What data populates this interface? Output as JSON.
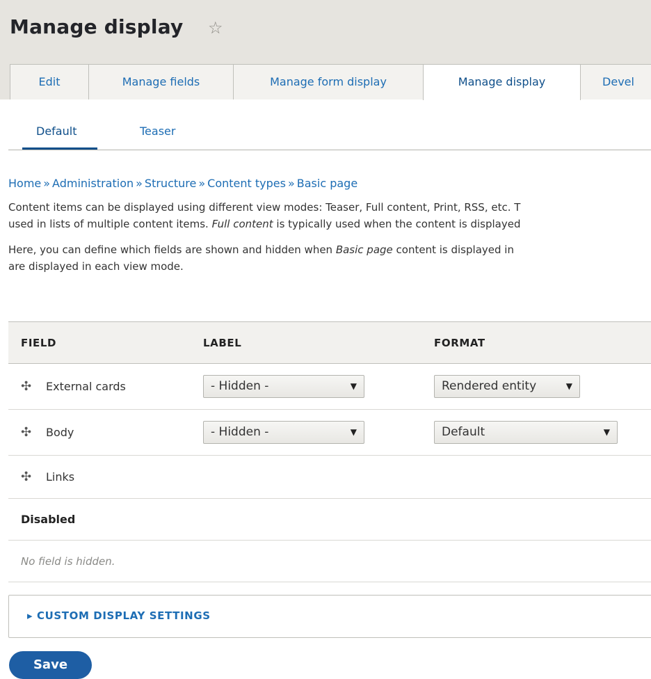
{
  "header": {
    "title": "Manage display",
    "star_icon": "☆"
  },
  "tabs": [
    {
      "label": "Edit",
      "active": false
    },
    {
      "label": "Manage fields",
      "active": false
    },
    {
      "label": "Manage form display",
      "active": false
    },
    {
      "label": "Manage display",
      "active": true
    },
    {
      "label": "Devel",
      "active": false
    }
  ],
  "secondary_tabs": [
    {
      "label": "Default",
      "active": true
    },
    {
      "label": "Teaser",
      "active": false
    }
  ],
  "breadcrumb": {
    "items": [
      "Home",
      "Administration",
      "Structure",
      "Content types",
      "Basic page"
    ],
    "separator": "»"
  },
  "description": {
    "p1_line1": "Content items can be displayed using different view modes: Teaser, Full content, Print, RSS, etc. T",
    "p1_line2_a": "used in lists of multiple content items. ",
    "p1_line2_em": "Full content",
    "p1_line2_b": " is typically used when the content is displayed",
    "p2_line1_a": "Here, you can define which fields are shown and hidden when ",
    "p2_line1_em": "Basic page",
    "p2_line1_b": " content is displayed in",
    "p2_line2": "are displayed in each view mode."
  },
  "table": {
    "headers": {
      "field": "FIELD",
      "label": "LABEL",
      "format": "FORMAT"
    },
    "rows": [
      {
        "name": "External cards",
        "label_value": "- Hidden -",
        "format_value": "Rendered entity"
      },
      {
        "name": "Body",
        "label_value": "- Hidden -",
        "format_value": "Default"
      },
      {
        "name": "Links"
      }
    ],
    "disabled_label": "Disabled",
    "empty_message": "No field is hidden."
  },
  "custom_display_settings": {
    "label": "CUSTOM DISPLAY SETTINGS",
    "icon": "▸"
  },
  "save_label": "Save",
  "icons": {
    "drag": "✣",
    "select_arrow": "▼"
  },
  "colors": {
    "link": "#1d6db4",
    "header_bg": "#e6e4df",
    "save_button": "#1e5ea4"
  }
}
